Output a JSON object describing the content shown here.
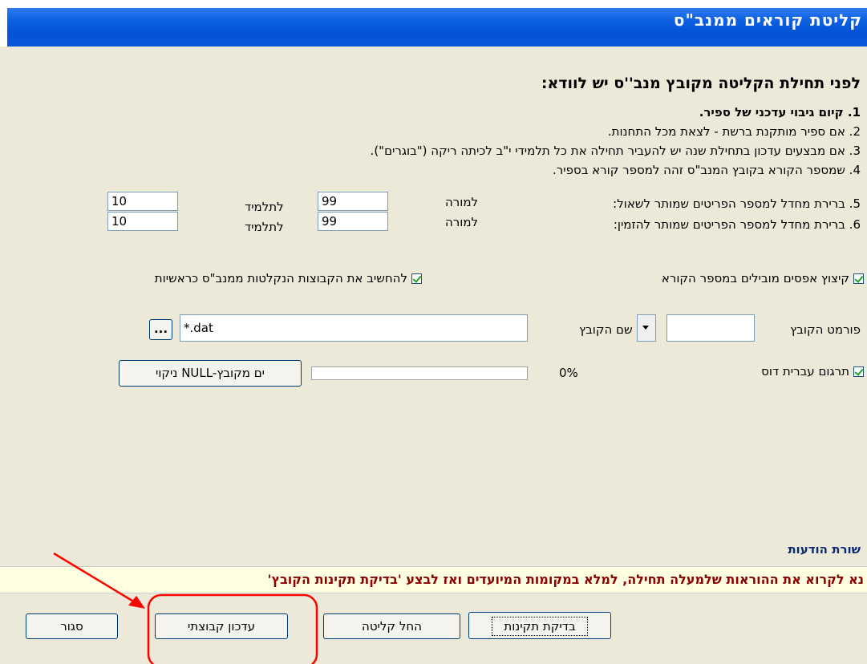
{
  "window": {
    "title": "קליטת קוראים ממנב\"ס"
  },
  "instructions": {
    "heading": "לפני תחילת הקליטה מקובץ מנב''ס יש לוודא:",
    "step1": "1. קיום גיבוי עדכני של ספיר.",
    "step2": "2. אם ספיר מותקנת ברשת - לצאת מכל התחנות.",
    "step3": "3. אם מבצעים עדכון בתחילת שנה יש להעביר תחילה את כל תלמידי י\"ב לכיתה ריקה (\"בוגרים\").",
    "step4": "4. שמספר הקורא בקובץ המנב\"ס זהה למספר קורא בספיר.",
    "step5": "5. ברירת מחדל למספר הפריטים שמותר לשאול:",
    "step6": "6. ברירת מחדל למספר הפריטים שמותר להזמין:"
  },
  "limits": {
    "teacher_label": "למורה",
    "student_label": "לתלמיד",
    "borrow_teacher": "99",
    "borrow_student": "10",
    "order_teacher": "99",
    "order_student": "10"
  },
  "options": {
    "trim_zeros": "קיצוץ אפסים מובילים במספר הקורא",
    "main_files": "להחשיב את הקבוצות הנקלטות ממנב\"ס כראשיות",
    "dos_hebrew": "תרגום עברית דוס"
  },
  "file": {
    "format_label": "פורמט הקובץ",
    "format_value": "",
    "name_label": "שם הקובץ",
    "name_value": "*.dat",
    "browse_label": "..."
  },
  "progress": {
    "percent_text": "0%",
    "value": 0
  },
  "null_cleanup_button": "ניקוי NULL-ים מקובץ",
  "messages": {
    "label": "שורת הודעות",
    "text": "נא לקרוא את ההוראות שלמעלה תחילה, למלא במקומות המיועדים ואז לבצע 'בדיקת תקינות הקובץ'"
  },
  "buttons": {
    "validate": "בדיקת תקינות",
    "start_import": "החל קליטה",
    "group_update": "עדכון קבוצתי",
    "close": "סגור"
  },
  "annotation_color": "#ff0000"
}
